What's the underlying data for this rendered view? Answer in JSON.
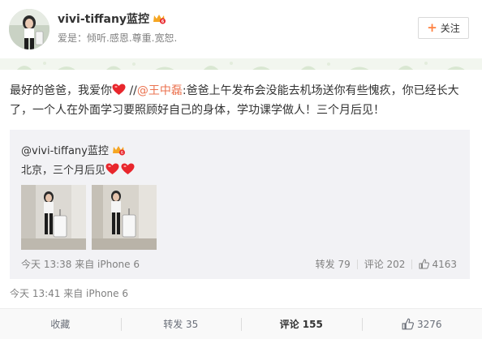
{
  "header": {
    "username": "vivi-tiffany蓝控",
    "bio": "爱是：倾听.感恩.尊重.宽恕.",
    "follow_label": "关注"
  },
  "post": {
    "text_before_heart": "最好的爸爸，我爱你",
    "repost_separator": " //",
    "mention": "@王中磊",
    "text_after_mention": ":爸爸上午发布会没能去机场送你有些愧疚，你已经长大了，一个人在外面学习要照顾好自己的身体，学功课学做人！三个月后见！",
    "time": "今天 13:41 来自 iPhone 6"
  },
  "quote": {
    "username": "@vivi-tiffany蓝控",
    "text": "北京，三个月后见",
    "time": "今天 13:38 来自 iPhone 6",
    "repost_label": "转发 79",
    "comment_label": "评论 202",
    "like_count": "4163"
  },
  "actions": {
    "favorite": "收藏",
    "repost": "转发 35",
    "comment": "评论 155",
    "like": "3276"
  },
  "colors": {
    "mention": "#eb7350",
    "heart": "#e8262c",
    "follow_plus": "#ff8140",
    "quote_bg": "#f2f2f5"
  },
  "icons": [
    "avatar",
    "vip-badge-icon",
    "heart-icon",
    "thumb-up-icon",
    "plus-icon"
  ]
}
